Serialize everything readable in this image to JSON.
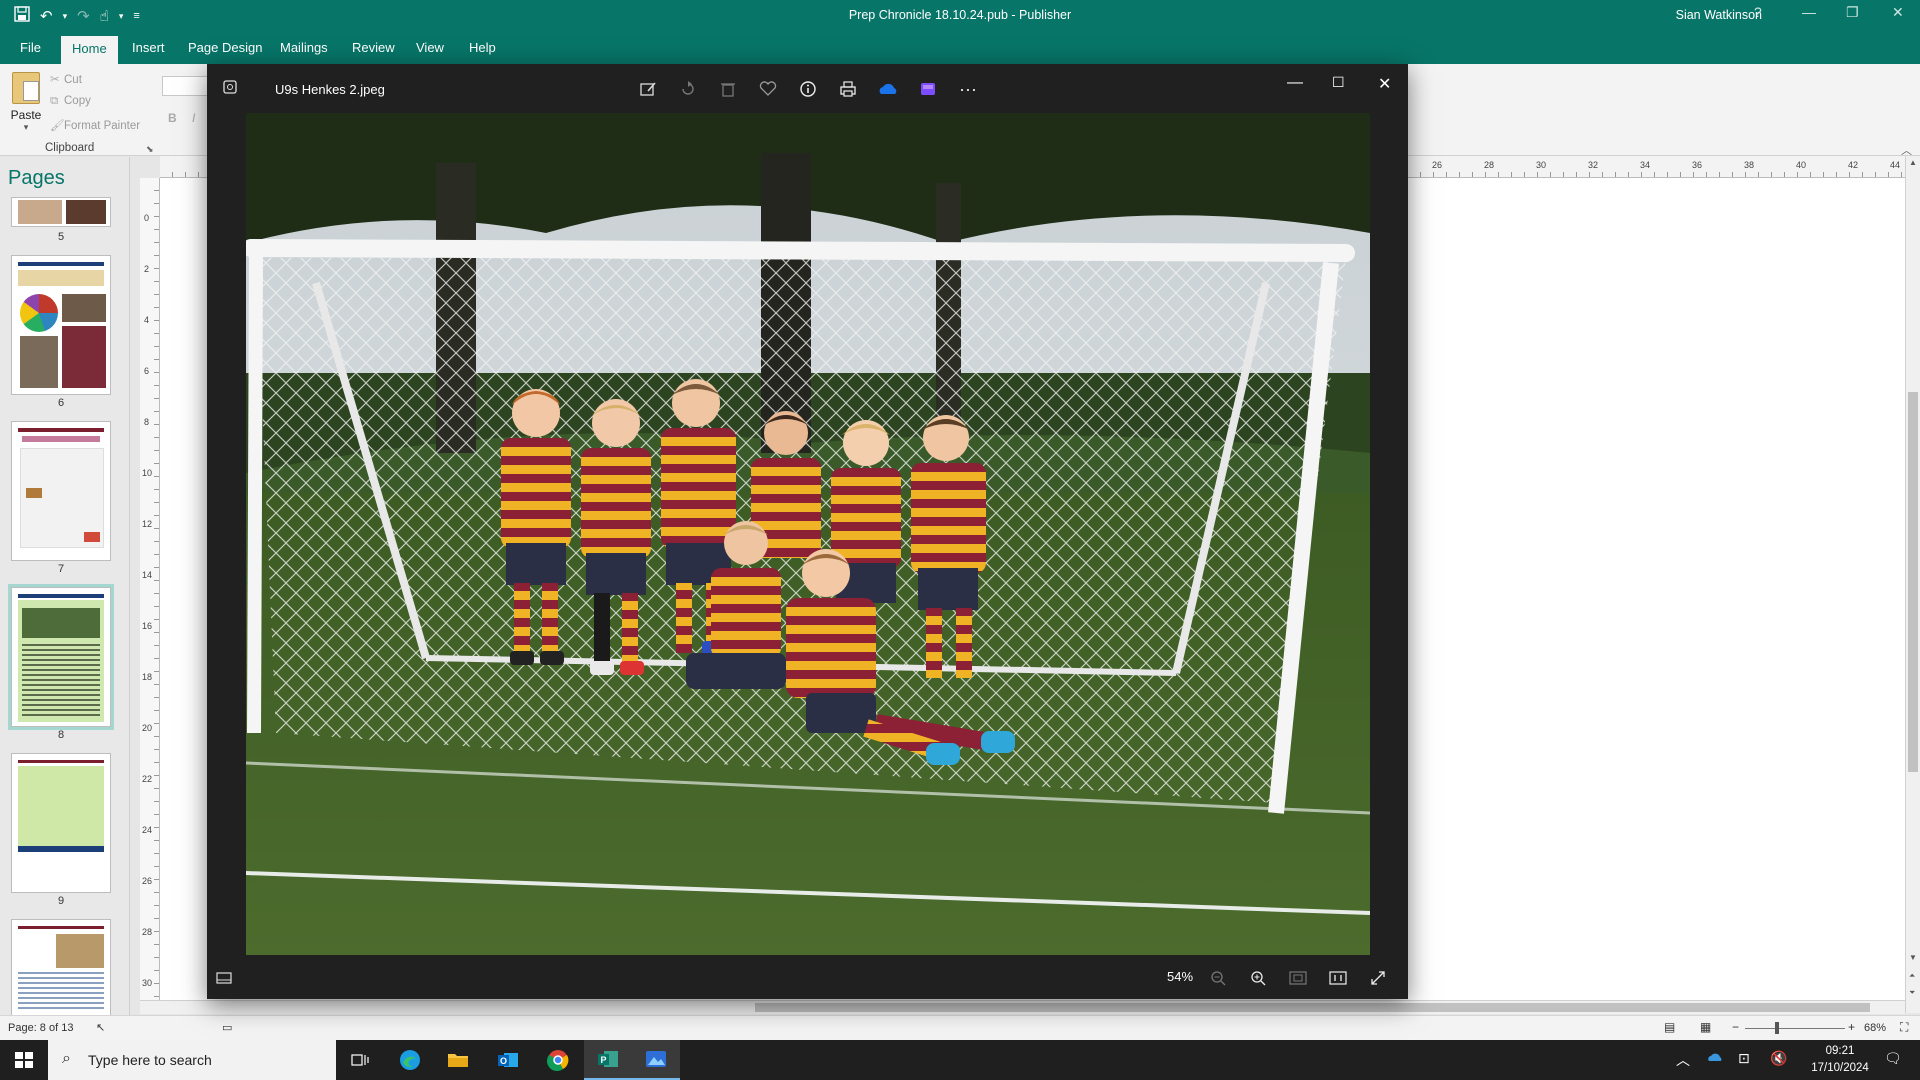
{
  "publisher": {
    "document_title": "Prep Chronicle 18.10.24.pub  -  Publisher",
    "user_name": "Sian Watkinson",
    "help": "?",
    "tabs": [
      "File",
      "Home",
      "Insert",
      "Page Design",
      "Mailings",
      "Review",
      "View",
      "Help"
    ],
    "active_tab": "Home",
    "clipboard": {
      "paste": "Paste",
      "cut": "Cut",
      "copy": "Copy",
      "format_painter": "Format Painter",
      "group_label": "Clipboard"
    },
    "format": {
      "bold": "B",
      "italic": "I"
    },
    "pages_pane_title": "Pages",
    "page_numbers": [
      "5",
      "6",
      "7",
      "8",
      "9"
    ],
    "selected_page": "8",
    "vruler_labels": [
      "0",
      "2",
      "4",
      "6",
      "8",
      "10",
      "12",
      "14",
      "16",
      "18",
      "20",
      "22",
      "24",
      "26",
      "28",
      "30"
    ],
    "hruler_labels": [
      "26",
      "28",
      "30",
      "32",
      "34",
      "36",
      "38",
      "40",
      "42",
      "44"
    ],
    "status_page": "Page: 8 of 13",
    "zoom_percent": "68%"
  },
  "photos_viewer": {
    "file_name": "U9s Henkes 2.jpeg",
    "zoom": "54%",
    "toolbar_icons": [
      "edit-image-icon",
      "rotate-icon",
      "delete-icon",
      "favorite-heart-icon",
      "info-icon",
      "print-icon",
      "onedrive-icon",
      "clipchamp-icon",
      "more-icon"
    ],
    "footer_icons": [
      "filmstrip-icon",
      "zoom-out-icon",
      "zoom-in-icon",
      "fit-window-icon",
      "actual-size-icon",
      "fullscreen-icon"
    ]
  },
  "taskbar": {
    "search_placeholder": "Type here to search",
    "time": "09:21",
    "date": "17/10/2024"
  },
  "colors": {
    "publisher_teal": "#077568",
    "photos_dark": "#202020",
    "taskbar": "#1f1f1f"
  }
}
